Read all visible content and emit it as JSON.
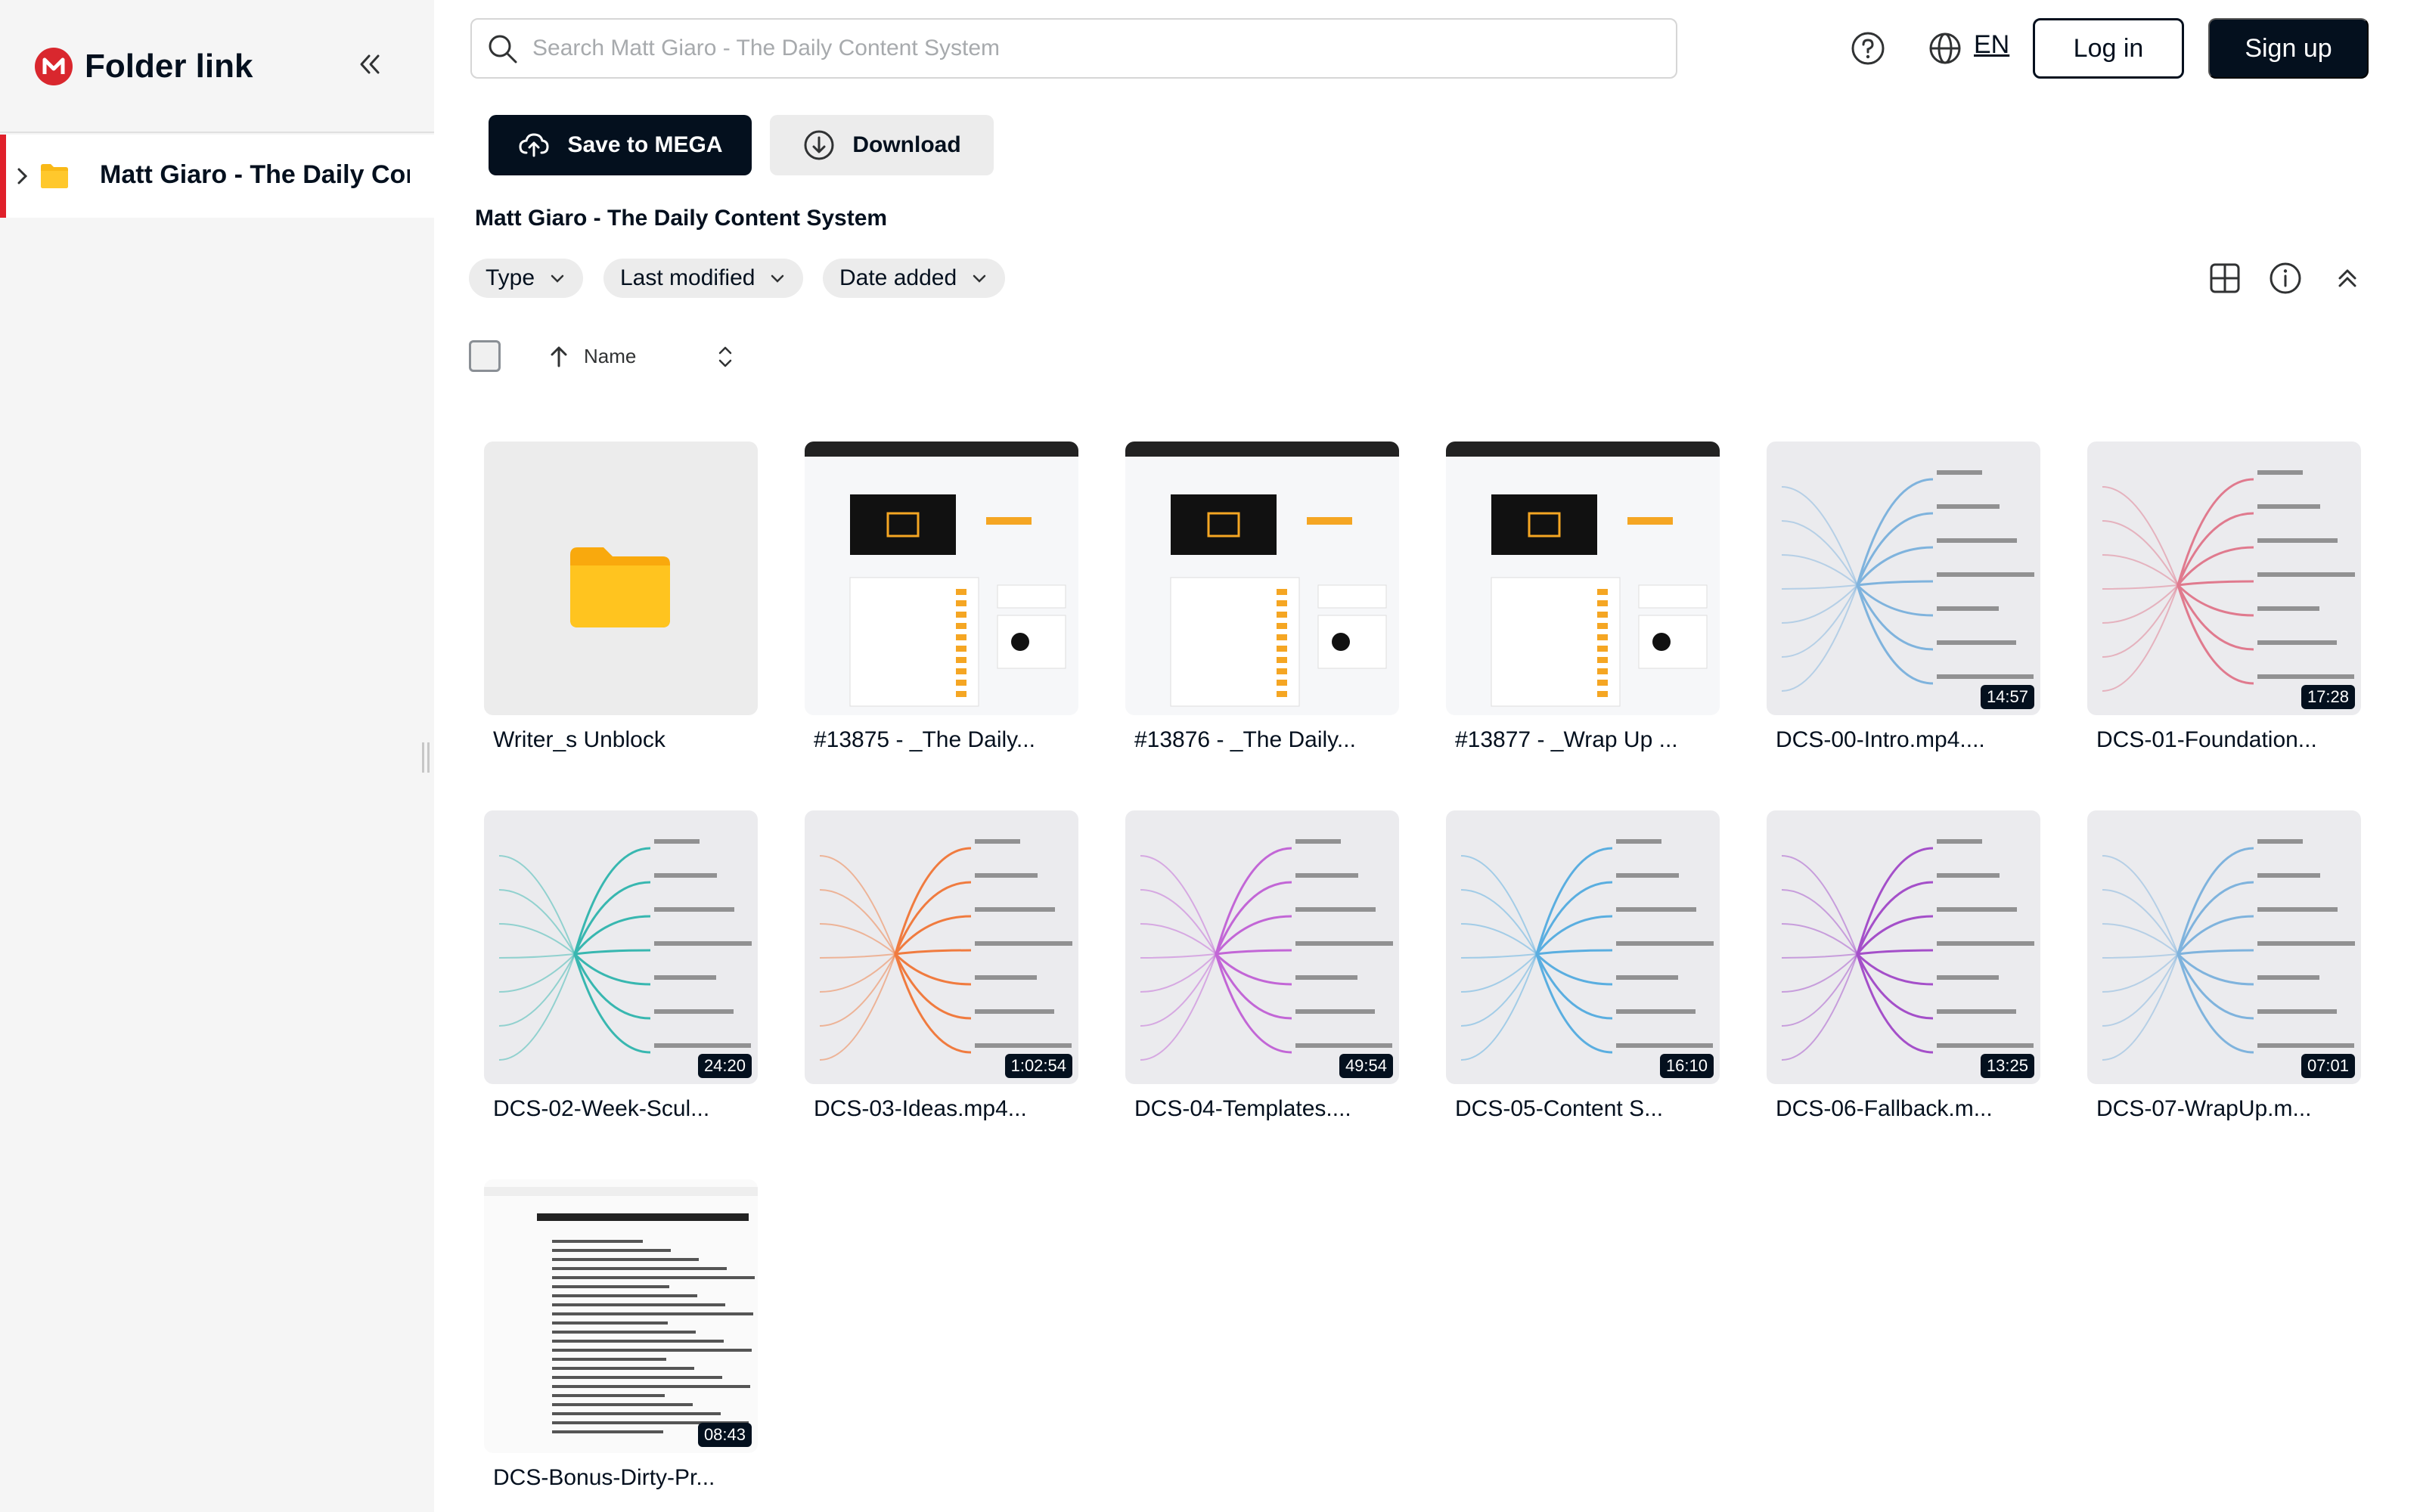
{
  "brand": {
    "title": "Folder link",
    "accent": "#d9272e"
  },
  "sidebar": {
    "tree": [
      {
        "label": "Matt Giaro - The Daily Content System"
      }
    ]
  },
  "header": {
    "search_placeholder": "Search Matt Giaro - The Daily Content System",
    "language": "EN",
    "login_label": "Log in",
    "signup_label": "Sign up"
  },
  "actions": {
    "save_label": "Save to MEGA",
    "download_label": "Download"
  },
  "folder": {
    "title": "Matt Giaro - The Daily Content System"
  },
  "filters": [
    {
      "label": "Type"
    },
    {
      "label": "Last modified"
    },
    {
      "label": "Date added"
    }
  ],
  "sort": {
    "label": "Name"
  },
  "items": [
    {
      "name": "Writer_s Unblock",
      "kind": "folder",
      "duration": ""
    },
    {
      "name": "#13875 - _The Daily...",
      "kind": "page",
      "duration": ""
    },
    {
      "name": "#13876 - _The Daily...",
      "kind": "page",
      "duration": ""
    },
    {
      "name": "#13877 - _Wrap Up ...",
      "kind": "page",
      "duration": ""
    },
    {
      "name": "DCS-00-Intro.mp4....",
      "kind": "mindmap",
      "duration": "14:57"
    },
    {
      "name": "DCS-01-Foundation...",
      "kind": "mindmap",
      "duration": "17:28"
    },
    {
      "name": "DCS-02-Week-Scul...",
      "kind": "mindmap",
      "duration": "24:20"
    },
    {
      "name": "DCS-03-Ideas.mp4...",
      "kind": "mindmap",
      "duration": "1:02:54"
    },
    {
      "name": "DCS-04-Templates....",
      "kind": "mindmap",
      "duration": "49:54"
    },
    {
      "name": "DCS-05-Content S...",
      "kind": "mindmap",
      "duration": "16:10"
    },
    {
      "name": "DCS-06-Fallback.m...",
      "kind": "mindmap",
      "duration": "13:25"
    },
    {
      "name": "DCS-07-WrapUp.m...",
      "kind": "mindmap",
      "duration": "07:01"
    },
    {
      "name": "DCS-Bonus-Dirty-Pr...",
      "kind": "doc",
      "duration": "08:43"
    }
  ]
}
